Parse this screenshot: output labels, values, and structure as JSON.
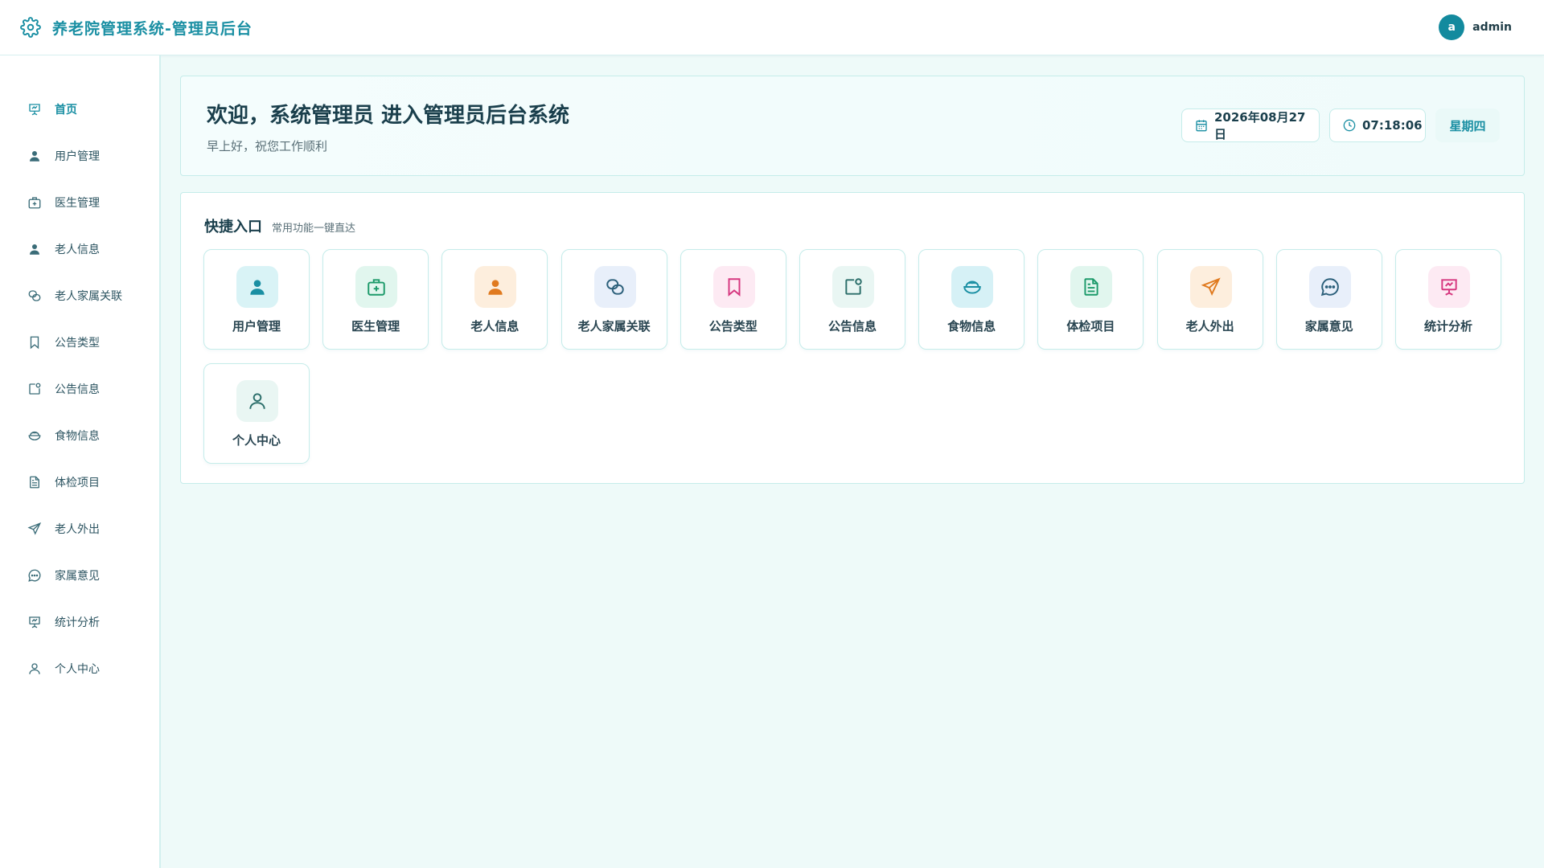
{
  "header": {
    "title": "养老院管理系统-管理员后台",
    "icon": "gear-icon",
    "user": {
      "avatar_letter": "a",
      "name": "admin"
    }
  },
  "sidebar": {
    "items": [
      {
        "label": "首页",
        "icon": "presentation-icon",
        "active": true
      },
      {
        "label": "用户管理",
        "icon": "user-filled-icon"
      },
      {
        "label": "医生管理",
        "icon": "medical-kit-icon"
      },
      {
        "label": "老人信息",
        "icon": "user-filled-icon"
      },
      {
        "label": "老人家属关联",
        "icon": "link-icon"
      },
      {
        "label": "公告类型",
        "icon": "bookmark-icon"
      },
      {
        "label": "公告信息",
        "icon": "notification-icon"
      },
      {
        "label": "食物信息",
        "icon": "bowl-icon"
      },
      {
        "label": "体检项目",
        "icon": "document-icon"
      },
      {
        "label": "老人外出",
        "icon": "send-icon"
      },
      {
        "label": "家属意见",
        "icon": "chat-icon"
      },
      {
        "label": "统计分析",
        "icon": "presentation-icon"
      },
      {
        "label": "个人中心",
        "icon": "user-outline-icon"
      }
    ]
  },
  "welcome": {
    "heading": "欢迎，系统管理员 进入管理员后台系统",
    "subtitle": "早上好，祝您工作顺利",
    "date": "2026年08月27日",
    "time": "07:18:06",
    "weekday": "星期四"
  },
  "quick": {
    "title": "快捷入口",
    "subtitle": "常用功能一键直达",
    "tiles": [
      {
        "label": "用户管理",
        "icon": "user-filled-icon",
        "bg": "#d9f3f6",
        "color": "#1a8fa3"
      },
      {
        "label": "医生管理",
        "icon": "medical-kit-icon",
        "bg": "#e1f6ee",
        "color": "#1c9a6a"
      },
      {
        "label": "老人信息",
        "icon": "user-filled-icon",
        "bg": "#fdeedd",
        "color": "#e07a1f"
      },
      {
        "label": "老人家属关联",
        "icon": "link-icon",
        "bg": "#e8effa",
        "color": "#2b5f7a"
      },
      {
        "label": "公告类型",
        "icon": "bookmark-icon",
        "bg": "#fdeaf3",
        "color": "#d6377f"
      },
      {
        "label": "公告信息",
        "icon": "notification-icon",
        "bg": "#e9f6f3",
        "color": "#2b6e6a"
      },
      {
        "label": "食物信息",
        "icon": "bowl-icon",
        "bg": "#d6f1f6",
        "color": "#1a8fa3"
      },
      {
        "label": "体检项目",
        "icon": "document-icon",
        "bg": "#e1f6ee",
        "color": "#1c9a6a"
      },
      {
        "label": "老人外出",
        "icon": "send-icon",
        "bg": "#fdeedd",
        "color": "#e07a1f"
      },
      {
        "label": "家属意见",
        "icon": "chat-icon",
        "bg": "#e8effa",
        "color": "#2b5f7a"
      },
      {
        "label": "统计分析",
        "icon": "presentation-icon",
        "bg": "#fdeaf3",
        "color": "#d6377f"
      },
      {
        "label": "个人中心",
        "icon": "user-outline-icon",
        "bg": "#e9f6f3",
        "color": "#2b6e6a"
      }
    ]
  }
}
